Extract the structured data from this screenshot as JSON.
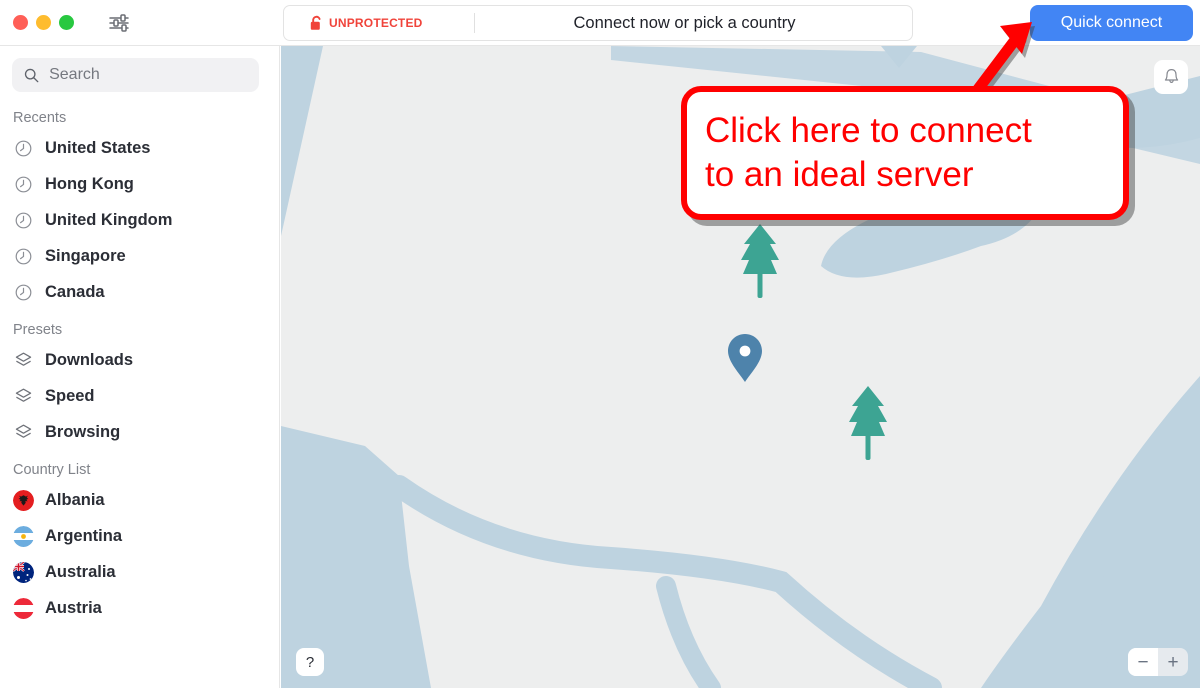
{
  "window": {
    "traffic_lights": [
      "close",
      "minimize",
      "maximize"
    ],
    "settings_icon": "sliders-icon"
  },
  "statusbar": {
    "lock_icon": "unlocked-padlock-icon",
    "protection_status": "UNPROTECTED",
    "protection_color": "#f0433a",
    "headline": "Connect now or pick a country"
  },
  "toolbar": {
    "quick_connect_label": "Quick connect",
    "quick_connect_color": "#4285f4"
  },
  "search": {
    "placeholder": "Search",
    "value": "",
    "icon": "search-icon"
  },
  "sidebar": {
    "sections": [
      {
        "title": "Recents",
        "icon": "clock-icon",
        "items": [
          {
            "label": "United States"
          },
          {
            "label": "Hong Kong"
          },
          {
            "label": "United Kingdom"
          },
          {
            "label": "Singapore"
          },
          {
            "label": "Canada"
          }
        ]
      },
      {
        "title": "Presets",
        "icon": "layers-icon",
        "items": [
          {
            "label": "Downloads"
          },
          {
            "label": "Speed"
          },
          {
            "label": "Browsing"
          }
        ]
      },
      {
        "title": "Country List",
        "icon": "flag-icon",
        "items": [
          {
            "label": "Albania",
            "flag": "albania-flag"
          },
          {
            "label": "Argentina",
            "flag": "argentina-flag"
          },
          {
            "label": "Australia",
            "flag": "australia-flag"
          },
          {
            "label": "Austria",
            "flag": "austria-flag"
          }
        ]
      }
    ]
  },
  "map": {
    "land_color": "#edeeee",
    "water_color": "#bed3e0",
    "tree_color": "#3da493",
    "pin_color": "#4e83ab",
    "markers": [
      {
        "type": "tree"
      },
      {
        "type": "tree"
      },
      {
        "type": "location-pin"
      }
    ],
    "bell_icon": "bell-icon",
    "help_label": "?",
    "zoom_out_label": "−",
    "zoom_in_label": "+"
  },
  "annotation": {
    "line1": "Click here to connect",
    "line2": "to an ideal server",
    "color": "#ff0000",
    "arrow": "arrow-up-right"
  }
}
